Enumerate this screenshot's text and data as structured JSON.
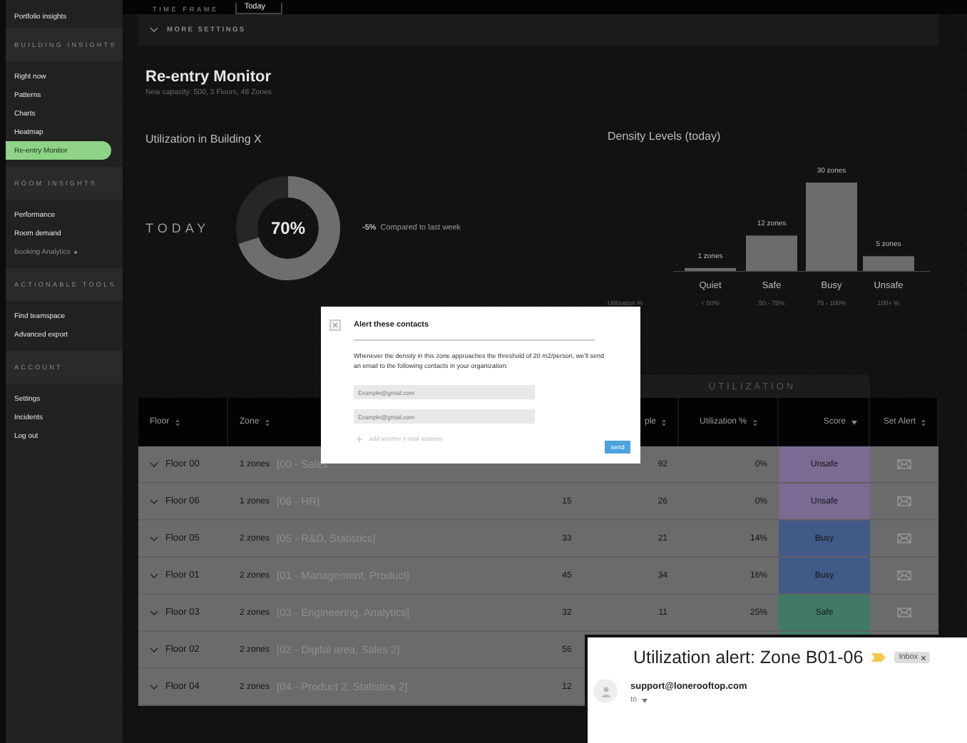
{
  "top_bar": {
    "label": "TIME FRAME",
    "value": "Today"
  },
  "more_settings": {
    "label": "MORE SETTINGS"
  },
  "sidebar": {
    "groups": [
      {
        "items": [
          {
            "label": "Portfolio insights",
            "selected": false,
            "disabled": false,
            "dot": false
          }
        ]
      },
      {
        "heading": "BUILDING INSIGHTS",
        "items": [
          {
            "label": "Right now",
            "selected": false,
            "disabled": false,
            "dot": false
          },
          {
            "label": "Patterns",
            "selected": false,
            "disabled": false,
            "dot": false
          },
          {
            "label": "Charts",
            "selected": false,
            "disabled": false,
            "dot": false
          },
          {
            "label": "Heatmap",
            "selected": false,
            "disabled": false,
            "dot": false
          },
          {
            "label": "Re-entry Monitor",
            "selected": true,
            "disabled": false,
            "dot": false
          }
        ]
      },
      {
        "heading": "ROOM INSIGHTS",
        "items": [
          {
            "label": "Performance",
            "selected": false,
            "disabled": false,
            "dot": false
          },
          {
            "label": "Room demand",
            "selected": false,
            "disabled": false,
            "dot": false
          },
          {
            "label": "Booking Analytics",
            "selected": false,
            "disabled": true,
            "dot": true
          }
        ]
      },
      {
        "heading": "ACTIONABLE TOOLS",
        "items": [
          {
            "label": "Find teamspace",
            "selected": false,
            "disabled": false,
            "dot": false
          },
          {
            "label": "Advanced export",
            "selected": false,
            "disabled": false,
            "dot": false
          }
        ]
      },
      {
        "heading": "ACCOUNT",
        "items": [
          {
            "label": "Settings",
            "selected": false,
            "disabled": false,
            "dot": false
          },
          {
            "label": "Incidents",
            "selected": false,
            "disabled": false,
            "dot": false
          },
          {
            "label": "Log out",
            "selected": false,
            "disabled": false,
            "dot": false
          }
        ]
      }
    ]
  },
  "page": {
    "title": "Re-entry Monitor",
    "subtitle": "New capacity: 500, 3 Floors, 48 Zones"
  },
  "utilization": {
    "heading": "Utilization in Building X",
    "period": "TODAY",
    "level": 0.7,
    "value": "70%",
    "delta": "-5%",
    "delta_note": "Compared to last week"
  },
  "density": {
    "heading": "Density Levels (today)",
    "range_label": "Utilization %",
    "ranges": [
      "< 50%",
      "50 - 75%",
      "75 - 100%",
      "100+ %"
    ],
    "chart_data": {
      "type": "bar",
      "categories": [
        "Quiet",
        "Safe",
        "Busy",
        "Unsafe"
      ],
      "values": [
        1,
        12,
        30,
        5
      ],
      "value_labels": [
        "1 zones",
        "12 zones",
        "30 zones",
        "5 zones"
      ]
    }
  },
  "table": {
    "group_heading": "UTILIZATION",
    "columns": [
      {
        "label": "Floor",
        "sorted": false
      },
      {
        "label": "Zone",
        "sorted": false
      },
      {
        "label": "ple",
        "sorted": false
      },
      {
        "label": "Utilization %",
        "sorted": false
      },
      {
        "label": "Score",
        "sorted": true
      },
      {
        "label": "Set Alert",
        "sorted": false
      }
    ],
    "rows": [
      {
        "floor": "Floor 00",
        "zone_count": "1 zones",
        "zone_detail": "[00 - Sales",
        "column_4": "92",
        "utilization": "0%",
        "score": "Unsafe",
        "color": "#7b6a92",
        "alert": true
      },
      {
        "floor": "Floor 06",
        "zone_count": "1 zones",
        "zone_detail": "[06 - HR]",
        "column_3": "15",
        "column_4": "26",
        "utilization": "0%",
        "score": "Unsafe",
        "color": "#7b6a92",
        "alert": true
      },
      {
        "floor": "Floor 05",
        "zone_count": "2 zones",
        "zone_detail": "[05 - R&D, Statistics]",
        "column_3": "33",
        "column_4": "21",
        "utilization": "14%",
        "score": "Busy",
        "color": "#425a88",
        "alert": true
      },
      {
        "floor": "Floor 01",
        "zone_count": "2 zones",
        "zone_detail": "[01 - Management, Product]",
        "column_3": "45",
        "column_4": "34",
        "utilization": "16%",
        "score": "Busy",
        "color": "#425a88",
        "alert": true
      },
      {
        "floor": "Floor 03",
        "zone_count": "2 zones",
        "zone_detail": "[03 - Engineering, Analytics]",
        "column_3": "32",
        "column_4": "11",
        "utilization": "25%",
        "score": "Safe",
        "color": "#407a66",
        "alert": true
      },
      {
        "floor": "Floor 02",
        "zone_count": "2 zones",
        "zone_detail": "[02 - Digital area, Sales 2]",
        "column_3": "56",
        "color": "#407a66",
        "alert": false
      },
      {
        "floor": "Floor 04",
        "zone_count": "2 zones",
        "zone_detail": "[04 - Product 2,  Statistics 2]",
        "column_3": "12",
        "alert": false
      }
    ]
  },
  "modal": {
    "title": "Alert these contacts",
    "message": "Whenever the density in this zone approaches the threshold of 20 m2/person, we'll send an email to the following contacts in your organization:",
    "emails": [
      {
        "placeholder": "Example@gmail.com"
      },
      {
        "placeholder": "Example@gmail.com"
      }
    ],
    "add_label": "add another e-mail address",
    "send": "send"
  },
  "email": {
    "subject": "Utilization alert: Zone B01-06",
    "label": "Inbox",
    "sender": "support@lonerooftop.com",
    "to": "to"
  }
}
